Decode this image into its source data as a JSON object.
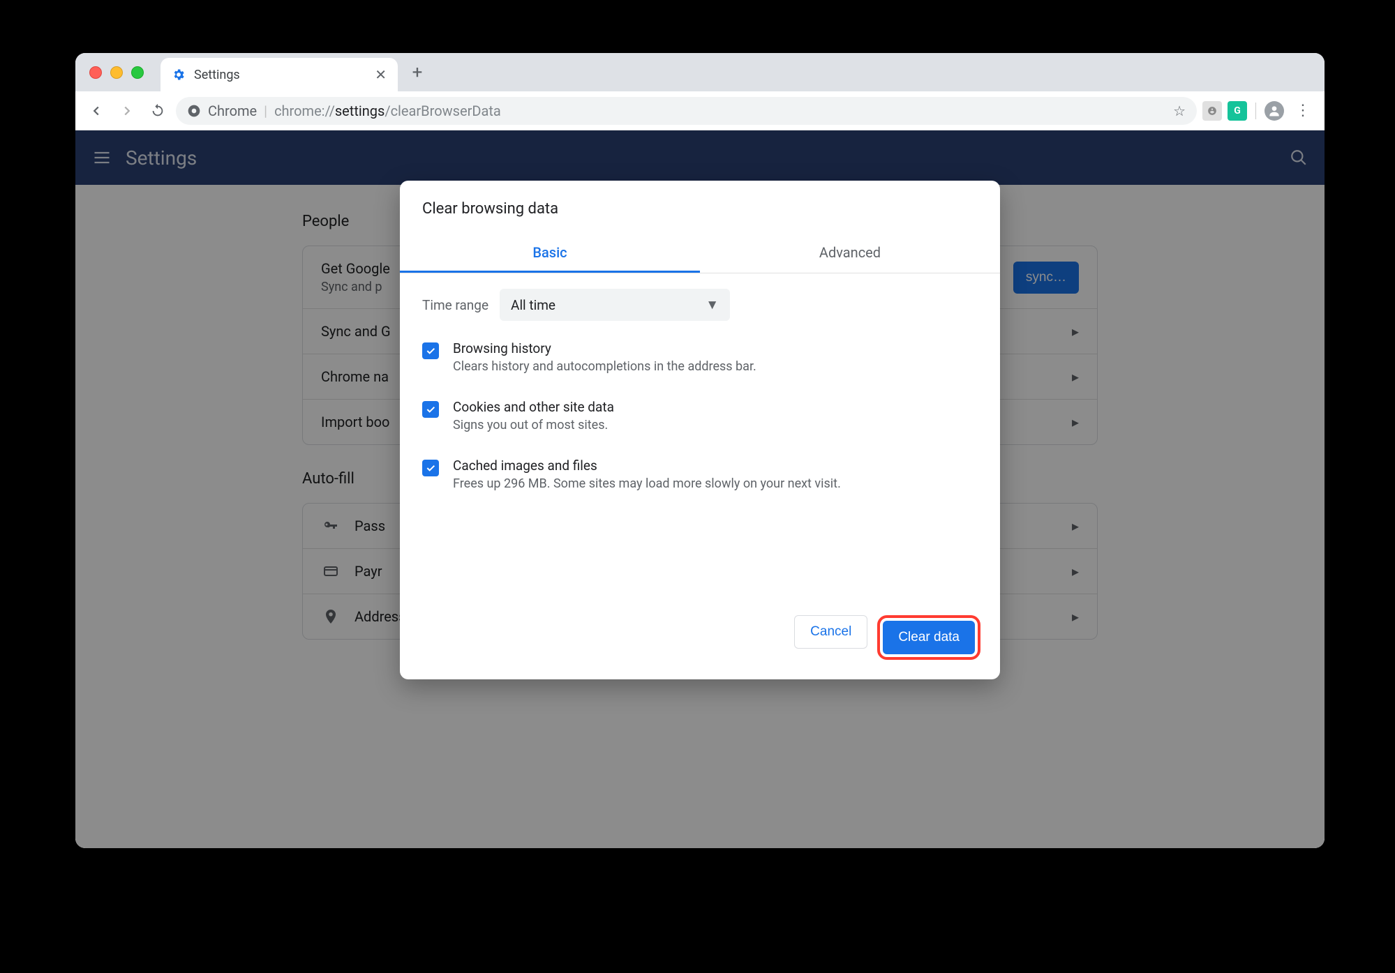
{
  "tab": {
    "title": "Settings"
  },
  "address": {
    "scheme": "Chrome",
    "url_prefix": "chrome://",
    "url_bold": "settings",
    "url_suffix": "/clearBrowserData"
  },
  "header": {
    "title": "Settings"
  },
  "sections": {
    "people": {
      "title": "People",
      "row0_title": "Get Google",
      "row0_sub": "Sync and p",
      "sync_btn": "sync…",
      "row1": "Sync and G",
      "row2": "Chrome na",
      "row3": "Import boo"
    },
    "autofill": {
      "title": "Auto-fill",
      "row0": "Pass",
      "row1": "Payr",
      "row2": "Addresses and more"
    }
  },
  "dialog": {
    "title": "Clear browsing data",
    "tab_basic": "Basic",
    "tab_advanced": "Advanced",
    "time_label": "Time range",
    "time_value": "All time",
    "opt1_title": "Browsing history",
    "opt1_sub": "Clears history and autocompletions in the address bar.",
    "opt2_title": "Cookies and other site data",
    "opt2_sub": "Signs you out of most sites.",
    "opt3_title": "Cached images and files",
    "opt3_sub": "Frees up 296 MB. Some sites may load more slowly on your next visit.",
    "cancel": "Cancel",
    "clear": "Clear data"
  }
}
